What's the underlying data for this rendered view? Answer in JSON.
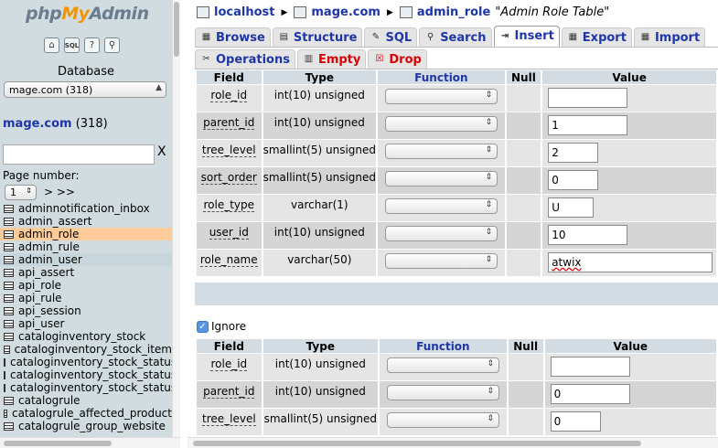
{
  "sidebar": {
    "logo_php": "php",
    "logo_my": "My",
    "logo_admin": "Admin",
    "database_label": "Database",
    "database_select": "mage.com (318)",
    "db_link_name": "mage.com",
    "db_link_count": "(318)",
    "filter_clear": "X",
    "page_number_label": "Page number:",
    "page_number_value": "1",
    "page_next": "> >>",
    "tables": [
      "adminnotification_inbox",
      "admin_assert",
      "admin_role",
      "admin_rule",
      "admin_user",
      "api_assert",
      "api_role",
      "api_rule",
      "api_session",
      "api_user",
      "cataloginventory_stock",
      "cataloginventory_stock_item",
      "cataloginventory_stock_status",
      "cataloginventory_stock_status",
      "cataloginventory_stock_status",
      "catalogrule",
      "catalogrule_affected_product",
      "catalogrule_group_website"
    ]
  },
  "breadcrumb": {
    "server": "localhost",
    "database": "mage.com",
    "table": "admin_role",
    "comment": "\"Admin Role Table\""
  },
  "tabs": {
    "browse": "Browse",
    "structure": "Structure",
    "sql": "SQL",
    "search": "Search",
    "insert": "Insert",
    "export": "Export",
    "import": "Import",
    "operations": "Operations",
    "empty": "Empty",
    "drop": "Drop"
  },
  "table_headers": {
    "field": "Field",
    "type": "Type",
    "function": "Function",
    "null": "Null",
    "value": "Value"
  },
  "rows1": [
    {
      "field": "role_id",
      "type": "int(10) unsigned",
      "value": ""
    },
    {
      "field": "parent_id",
      "type": "int(10) unsigned",
      "value": "1"
    },
    {
      "field": "tree_level",
      "type": "smallint(5) unsigned",
      "value": "2"
    },
    {
      "field": "sort_order",
      "type": "smallint(5) unsigned",
      "value": "0"
    },
    {
      "field": "role_type",
      "type": "varchar(1)",
      "value": "U"
    },
    {
      "field": "user_id",
      "type": "int(10) unsigned",
      "value": "10"
    },
    {
      "field": "role_name",
      "type": "varchar(50)",
      "value": "atwix"
    }
  ],
  "ignore_label": "Ignore",
  "rows2": [
    {
      "field": "role_id",
      "type": "int(10) unsigned",
      "value": ""
    },
    {
      "field": "parent_id",
      "type": "int(10) unsigned",
      "value": "0"
    },
    {
      "field": "tree_level",
      "type": "smallint(5) unsigned",
      "value": "0"
    }
  ]
}
